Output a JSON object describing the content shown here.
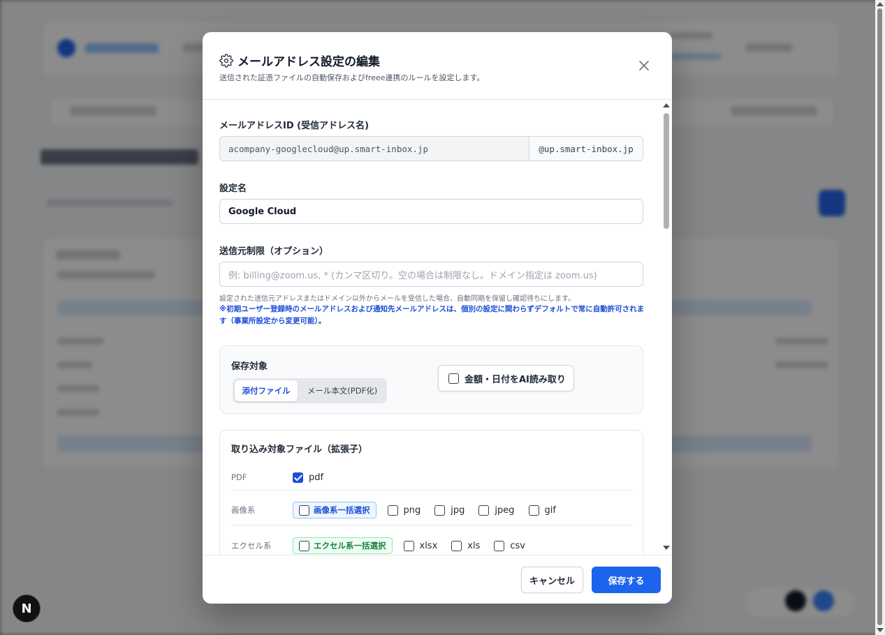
{
  "modal": {
    "title": "メールアドレス設定の編集",
    "subtitle": "送信された証憑ファイルの自動保存およびfreee連携のルールを設定します。"
  },
  "email_id": {
    "label": "メールアドレスID (受信アドレス名)",
    "value": "acompany-googlecloud@up.smart-inbox.jp",
    "suffix": "@up.smart-inbox.jp"
  },
  "setting_name": {
    "label": "設定名",
    "value": "Google Cloud"
  },
  "sender_restriction": {
    "label": "送信元制限（オプション）",
    "placeholder": "例: billing@zoom.us, * (カンマ区切り。空の場合は制限なし。ドメイン指定は zoom.us)",
    "help": "設定された送信元アドレスまたはドメイン以外からメールを受信した場合、自動同期を保留し確認待ちにします。",
    "note": "※初期ユーザー登録時のメールアドレスおよび通知先メールアドレスは、個別の設定に関わらずデフォルトで常に自動許可されます（事業所設定から変更可能）。"
  },
  "save_target": {
    "title": "保存対象",
    "options": [
      "添付ファイル",
      "メール本文(PDF化)"
    ],
    "selected": "添付ファイル",
    "ai_label": "金額・日付をAI読み取り",
    "ai_checked": false
  },
  "file_types": {
    "title": "取り込み対象ファイル（拡張子）",
    "rows": [
      {
        "label": "PDF",
        "items": [
          {
            "name": "pdf",
            "checked": true
          }
        ]
      },
      {
        "label": "画像系",
        "bulk": "画像系一括選択",
        "items": [
          {
            "name": "png",
            "checked": false
          },
          {
            "name": "jpg",
            "checked": false
          },
          {
            "name": "jpeg",
            "checked": false
          },
          {
            "name": "gif",
            "checked": false
          }
        ]
      },
      {
        "label": "エクセル系",
        "bulk": "エクセル系一括選択",
        "items": [
          {
            "name": "xlsx",
            "checked": false
          },
          {
            "name": "xls",
            "checked": false
          },
          {
            "name": "csv",
            "checked": false
          }
        ]
      }
    ]
  },
  "footer": {
    "cancel": "キャンセル",
    "save": "保存する"
  },
  "dev_badge": "N",
  "colors": {
    "primary": "#1d63ed",
    "accent_text": "#1d4ed8",
    "green_chip": "#15803d"
  }
}
